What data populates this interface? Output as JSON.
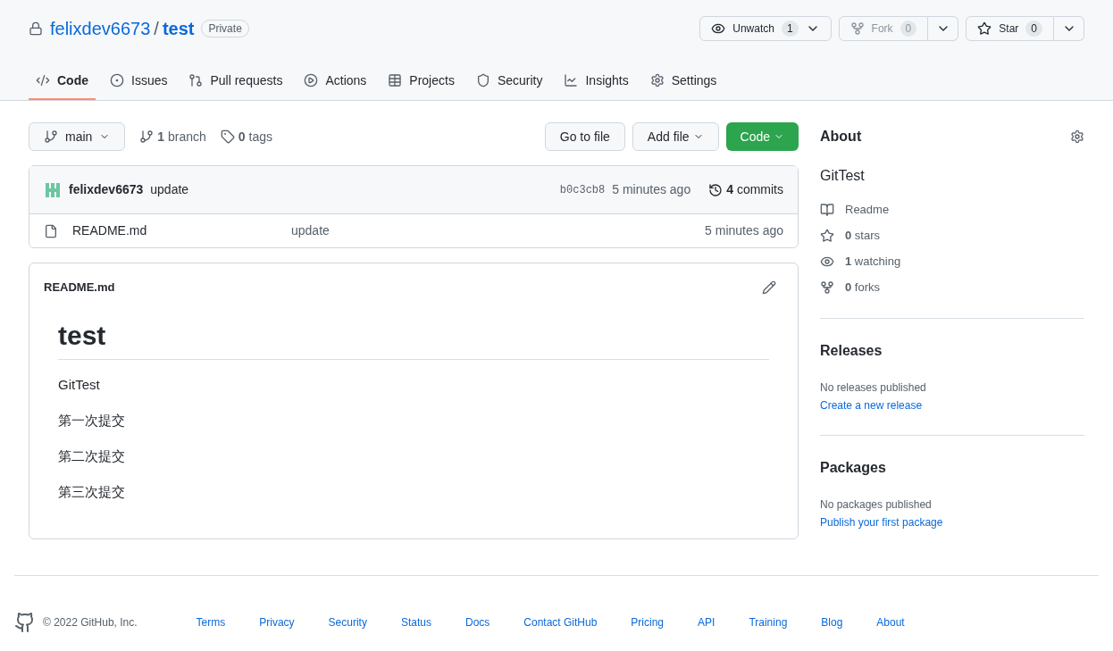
{
  "repo": {
    "owner": "felixdev6673",
    "separator": "/",
    "name": "test",
    "visibility": "Private"
  },
  "repo_buttons": [
    {
      "kind": "watch",
      "label": "Unwatch",
      "count": "1",
      "disabled": false
    },
    {
      "kind": "fork",
      "label": "Fork",
      "count": "0",
      "disabled": true
    },
    {
      "kind": "star",
      "label": "Star",
      "count": "0",
      "disabled": false
    }
  ],
  "tabs": [
    {
      "kind": "code",
      "label": "Code",
      "selected": true
    },
    {
      "kind": "issues",
      "label": "Issues",
      "selected": false
    },
    {
      "kind": "pulls",
      "label": "Pull requests",
      "selected": false
    },
    {
      "kind": "actions",
      "label": "Actions",
      "selected": false
    },
    {
      "kind": "projects",
      "label": "Projects",
      "selected": false
    },
    {
      "kind": "security",
      "label": "Security",
      "selected": false
    },
    {
      "kind": "insights",
      "label": "Insights",
      "selected": false
    },
    {
      "kind": "settings",
      "label": "Settings",
      "selected": false
    }
  ],
  "branch_bar": {
    "branch": "main",
    "branches": "**1** branch",
    "tags": "**0** tags",
    "go_to_file": "Go to file",
    "add_file": "Add file",
    "code": "Code"
  },
  "latest_commit": {
    "author": "felixdev6673",
    "message": "update",
    "hash": "b0c3cb8",
    "time": "5 minutes ago",
    "commits": "**4** commits"
  },
  "files": [
    {
      "name": "README.md",
      "message": "update",
      "time": "5 minutes ago"
    }
  ],
  "readme": {
    "filename": "README.md",
    "heading": "test",
    "paragraphs": [
      "GitTest",
      "第一次提交",
      "第二次提交",
      "第三次提交"
    ]
  },
  "about": {
    "title": "About",
    "description": "GitTest",
    "stats": [
      {
        "kind": "readme",
        "text": "Readme"
      },
      {
        "kind": "stars",
        "text": "**0** stars"
      },
      {
        "kind": "watching",
        "text": "**1** watching"
      },
      {
        "kind": "forks",
        "text": "**0** forks"
      }
    ]
  },
  "releases": {
    "title": "Releases",
    "note": "No releases published",
    "link": "Create a new release"
  },
  "packages": {
    "title": "Packages",
    "note": "No packages published",
    "link": "Publish your first package"
  },
  "footer": {
    "copyright": "© 2022 GitHub, Inc.",
    "links": [
      "Terms",
      "Privacy",
      "Security",
      "Status",
      "Docs",
      "Contact GitHub",
      "Pricing",
      "API",
      "Training",
      "Blog",
      "About"
    ]
  }
}
